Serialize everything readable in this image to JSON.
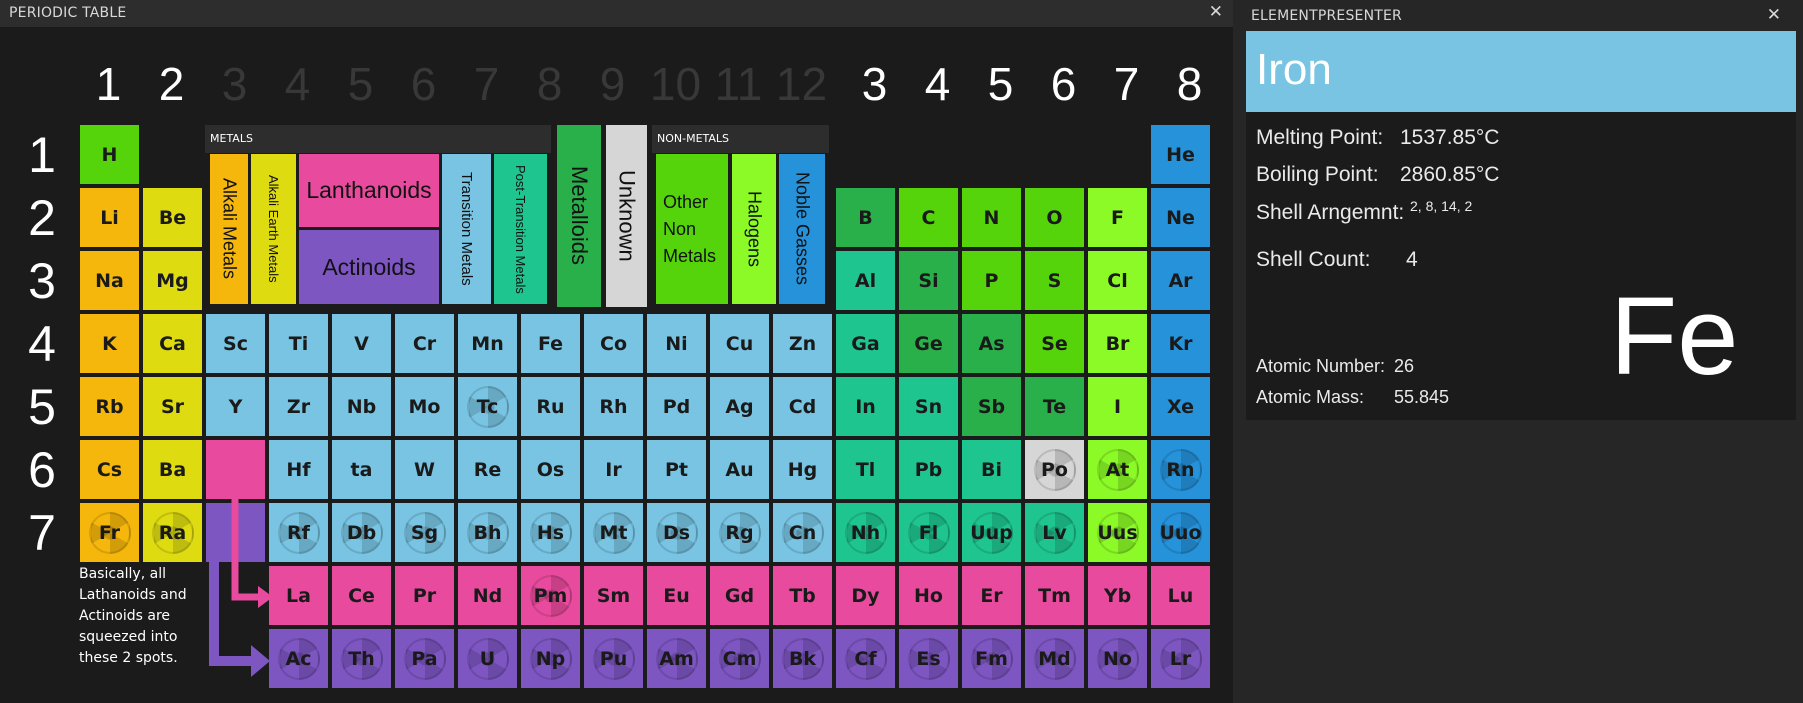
{
  "periodic_pane": {
    "title": "PERIODIC TABLE",
    "close_glyph": "✕",
    "group_headers": [
      "1",
      "2",
      "3",
      "4",
      "5",
      "6",
      "7",
      "8",
      "9",
      "10",
      "11",
      "12",
      "3",
      "4",
      "5",
      "6",
      "7",
      "8"
    ],
    "period_headers": [
      "1",
      "2",
      "3",
      "4",
      "5",
      "6",
      "7"
    ],
    "legend": {
      "metals_header": "METALS",
      "nonmetals_header": "NON-METALS",
      "alkali_metals": "Alkali Metals",
      "alkali_earth_metals": "Alkali Earth Metals",
      "lanthanoids": "Lanthanoids",
      "actinoids": "Actinoids",
      "transition_metals": "Transition Metals",
      "post_transition_metals": "Post-Transition Metals",
      "metalloids": "Metalloids",
      "unknown": "Unknown",
      "other_nonmetals": "Other Non Metals",
      "halogens": "Halogens",
      "noble_gasses": "Noble Gasses"
    },
    "note": "Basically, all Lathanoids and Actinoids are squeezed into these 2 spots.",
    "colors": {
      "alkali": "#f5b70b",
      "alkaline_earth": "#dedb11",
      "lanthanoid": "#e84b9d",
      "actinoid": "#7d56c2",
      "transition": "#78c4e2",
      "post_transition": "#1fc58f",
      "metalloid": "#2ab04a",
      "unknown": "#d6d6d6",
      "other_nonmetal": "#55d40b",
      "halogen": "#8bfa26",
      "noble": "#2592da"
    },
    "elements": [
      {
        "s": "H",
        "c": "other_nonmetal"
      },
      {
        "s": "He",
        "c": "noble"
      },
      {
        "s": "Li",
        "c": "alkali"
      },
      {
        "s": "Be",
        "c": "alkaline_earth"
      },
      {
        "s": "B",
        "c": "metalloid"
      },
      {
        "s": "C",
        "c": "other_nonmetal"
      },
      {
        "s": "N",
        "c": "other_nonmetal"
      },
      {
        "s": "O",
        "c": "other_nonmetal"
      },
      {
        "s": "F",
        "c": "halogen"
      },
      {
        "s": "Ne",
        "c": "noble"
      },
      {
        "s": "Na",
        "c": "alkali"
      },
      {
        "s": "Mg",
        "c": "alkaline_earth"
      },
      {
        "s": "Al",
        "c": "post_transition"
      },
      {
        "s": "Si",
        "c": "metalloid"
      },
      {
        "s": "P",
        "c": "other_nonmetal"
      },
      {
        "s": "S",
        "c": "other_nonmetal"
      },
      {
        "s": "Cl",
        "c": "halogen"
      },
      {
        "s": "Ar",
        "c": "noble"
      },
      {
        "s": "K",
        "c": "alkali"
      },
      {
        "s": "Ca",
        "c": "alkaline_earth"
      },
      {
        "s": "Sc",
        "c": "transition"
      },
      {
        "s": "Ti",
        "c": "transition"
      },
      {
        "s": "V",
        "c": "transition"
      },
      {
        "s": "Cr",
        "c": "transition"
      },
      {
        "s": "Mn",
        "c": "transition"
      },
      {
        "s": "Fe",
        "c": "transition"
      },
      {
        "s": "Co",
        "c": "transition"
      },
      {
        "s": "Ni",
        "c": "transition"
      },
      {
        "s": "Cu",
        "c": "transition"
      },
      {
        "s": "Zn",
        "c": "transition"
      },
      {
        "s": "Ga",
        "c": "post_transition"
      },
      {
        "s": "Ge",
        "c": "metalloid"
      },
      {
        "s": "As",
        "c": "metalloid"
      },
      {
        "s": "Se",
        "c": "other_nonmetal"
      },
      {
        "s": "Br",
        "c": "halogen"
      },
      {
        "s": "Kr",
        "c": "noble"
      },
      {
        "s": "Rb",
        "c": "alkali"
      },
      {
        "s": "Sr",
        "c": "alkaline_earth"
      },
      {
        "s": "Y",
        "c": "transition"
      },
      {
        "s": "Zr",
        "c": "transition"
      },
      {
        "s": "Nb",
        "c": "transition"
      },
      {
        "s": "Mo",
        "c": "transition"
      },
      {
        "s": "Tc",
        "c": "transition",
        "r": true
      },
      {
        "s": "Ru",
        "c": "transition"
      },
      {
        "s": "Rh",
        "c": "transition"
      },
      {
        "s": "Pd",
        "c": "transition"
      },
      {
        "s": "Ag",
        "c": "transition"
      },
      {
        "s": "Cd",
        "c": "transition"
      },
      {
        "s": "In",
        "c": "post_transition"
      },
      {
        "s": "Sn",
        "c": "post_transition"
      },
      {
        "s": "Sb",
        "c": "metalloid"
      },
      {
        "s": "Te",
        "c": "metalloid"
      },
      {
        "s": "I",
        "c": "halogen"
      },
      {
        "s": "Xe",
        "c": "noble"
      },
      {
        "s": "Cs",
        "c": "alkali"
      },
      {
        "s": "Ba",
        "c": "alkaline_earth"
      },
      {
        "s": "",
        "c": "lanthanoid"
      },
      {
        "s": "Hf",
        "c": "transition"
      },
      {
        "s": "ta",
        "c": "transition"
      },
      {
        "s": "W",
        "c": "transition"
      },
      {
        "s": "Re",
        "c": "transition"
      },
      {
        "s": "Os",
        "c": "transition"
      },
      {
        "s": "Ir",
        "c": "transition"
      },
      {
        "s": "Pt",
        "c": "transition"
      },
      {
        "s": "Au",
        "c": "transition"
      },
      {
        "s": "Hg",
        "c": "transition"
      },
      {
        "s": "Tl",
        "c": "post_transition"
      },
      {
        "s": "Pb",
        "c": "post_transition"
      },
      {
        "s": "Bi",
        "c": "post_transition"
      },
      {
        "s": "Po",
        "c": "unknown",
        "r": true
      },
      {
        "s": "At",
        "c": "halogen",
        "r": true
      },
      {
        "s": "Rn",
        "c": "noble",
        "r": true
      },
      {
        "s": "Fr",
        "c": "alkali",
        "r": true
      },
      {
        "s": "Ra",
        "c": "alkaline_earth",
        "r": true
      },
      {
        "s": "",
        "c": "actinoid"
      },
      {
        "s": "Rf",
        "c": "transition",
        "r": true
      },
      {
        "s": "Db",
        "c": "transition",
        "r": true
      },
      {
        "s": "Sg",
        "c": "transition",
        "r": true
      },
      {
        "s": "Bh",
        "c": "transition",
        "r": true
      },
      {
        "s": "Hs",
        "c": "transition",
        "r": true
      },
      {
        "s": "Mt",
        "c": "transition",
        "r": true
      },
      {
        "s": "Ds",
        "c": "transition",
        "r": true
      },
      {
        "s": "Rg",
        "c": "transition",
        "r": true
      },
      {
        "s": "Cn",
        "c": "transition",
        "r": true
      },
      {
        "s": "Nh",
        "c": "post_transition",
        "r": true
      },
      {
        "s": "Fl",
        "c": "post_transition",
        "r": true
      },
      {
        "s": "Uup",
        "c": "post_transition",
        "r": true
      },
      {
        "s": "Lv",
        "c": "post_transition",
        "r": true
      },
      {
        "s": "Uus",
        "c": "halogen",
        "r": true
      },
      {
        "s": "Uuo",
        "c": "noble",
        "r": true
      },
      {
        "s": "La",
        "c": "lanthanoid"
      },
      {
        "s": "Ce",
        "c": "lanthanoid"
      },
      {
        "s": "Pr",
        "c": "lanthanoid"
      },
      {
        "s": "Nd",
        "c": "lanthanoid"
      },
      {
        "s": "Pm",
        "c": "lanthanoid",
        "r": true
      },
      {
        "s": "Sm",
        "c": "lanthanoid"
      },
      {
        "s": "Eu",
        "c": "lanthanoid"
      },
      {
        "s": "Gd",
        "c": "lanthanoid"
      },
      {
        "s": "Tb",
        "c": "lanthanoid"
      },
      {
        "s": "Dy",
        "c": "lanthanoid"
      },
      {
        "s": "Ho",
        "c": "lanthanoid"
      },
      {
        "s": "Er",
        "c": "lanthanoid"
      },
      {
        "s": "Tm",
        "c": "lanthanoid"
      },
      {
        "s": "Yb",
        "c": "lanthanoid"
      },
      {
        "s": "Lu",
        "c": "lanthanoid"
      },
      {
        "s": "Ac",
        "c": "actinoid",
        "r": true
      },
      {
        "s": "Th",
        "c": "actinoid",
        "r": true
      },
      {
        "s": "Pa",
        "c": "actinoid",
        "r": true
      },
      {
        "s": "U",
        "c": "actinoid",
        "r": true
      },
      {
        "s": "Np",
        "c": "actinoid",
        "r": true
      },
      {
        "s": "Pu",
        "c": "actinoid",
        "r": true
      },
      {
        "s": "Am",
        "c": "actinoid",
        "r": true
      },
      {
        "s": "Cm",
        "c": "actinoid",
        "r": true
      },
      {
        "s": "Bk",
        "c": "actinoid",
        "r": true
      },
      {
        "s": "Cf",
        "c": "actinoid",
        "r": true
      },
      {
        "s": "Es",
        "c": "actinoid",
        "r": true
      },
      {
        "s": "Fm",
        "c": "actinoid",
        "r": true
      },
      {
        "s": "Md",
        "c": "actinoid",
        "r": true
      },
      {
        "s": "No",
        "c": "actinoid",
        "r": true
      },
      {
        "s": "Lr",
        "c": "actinoid",
        "r": true
      }
    ]
  },
  "presenter": {
    "title": "ELEMENTPRESENTER",
    "close_glyph": "✕",
    "header_color": "#78c4e2",
    "name": "Iron",
    "symbol": "Fe",
    "melting_label": "Melting Point:",
    "melting_value": "1537.85°C",
    "boiling_label": "Boiling Point:",
    "boiling_value": "2860.85°C",
    "shell_label": "Shell Arngemnt:",
    "shell_value": "2, 8, 14, 2",
    "count_label": "Shell Count:",
    "count_value": "4",
    "atomic_number_label": "Atomic Number:",
    "atomic_number_value": "26",
    "atomic_mass_label": "Atomic Mass:",
    "atomic_mass_value": "55.845"
  }
}
